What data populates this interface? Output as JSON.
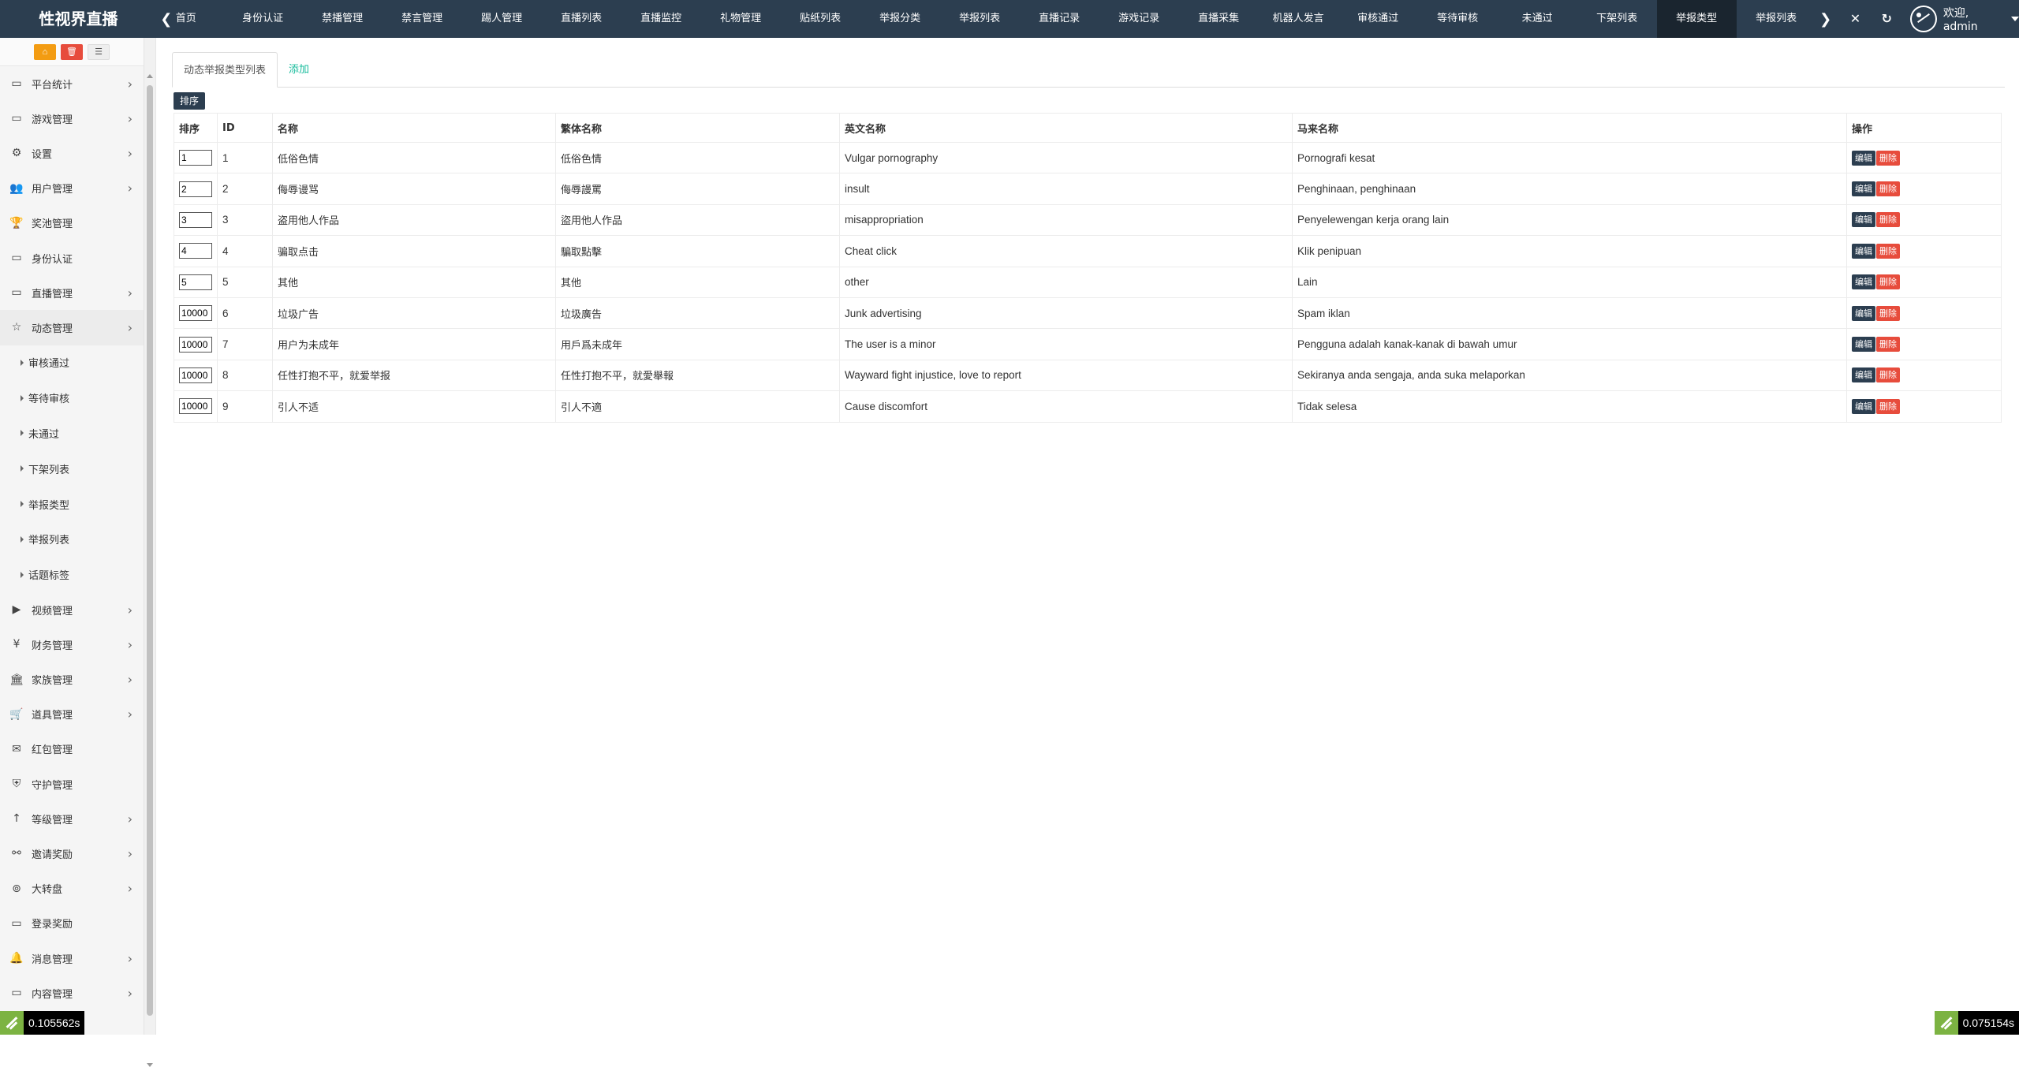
{
  "brand": "性视界直播",
  "topnav": {
    "tabs": [
      "首页",
      "身份认证",
      "禁播管理",
      "禁言管理",
      "踢人管理",
      "直播列表",
      "直播监控",
      "礼物管理",
      "贴纸列表",
      "举报分类",
      "举报列表",
      "直播记录",
      "游戏记录",
      "直播采集",
      "机器人发言",
      "审核通过",
      "等待审核",
      "未通过",
      "下架列表",
      "举报类型",
      "举报列表"
    ],
    "active_tab_index": 19,
    "user_greeting": "欢迎, admin"
  },
  "sidebar": {
    "tools": [
      "home-icon",
      "trash-icon",
      "list-icon"
    ],
    "items": [
      {
        "label": "平台统计",
        "icon": "monitor-icon",
        "glyph": "▭",
        "has_children": true
      },
      {
        "label": "游戏管理",
        "icon": "monitor-icon",
        "glyph": "▭",
        "has_children": true
      },
      {
        "label": "设置",
        "icon": "gears-icon",
        "glyph": "⚙",
        "has_children": true
      },
      {
        "label": "用户管理",
        "icon": "users-icon",
        "glyph": "👥",
        "has_children": true
      },
      {
        "label": "奖池管理",
        "icon": "trophy-icon",
        "glyph": "🏆",
        "has_children": false
      },
      {
        "label": "身份认证",
        "icon": "monitor-icon",
        "glyph": "▭",
        "has_children": false
      },
      {
        "label": "直播管理",
        "icon": "monitor-icon",
        "glyph": "▭",
        "has_children": true
      },
      {
        "label": "动态管理",
        "icon": "star-icon",
        "glyph": "☆",
        "has_children": true,
        "open": true
      }
    ],
    "subitems": [
      "审核通过",
      "等待审核",
      "未通过",
      "下架列表",
      "举报类型",
      "举报列表",
      "话题标签"
    ],
    "items_after": [
      {
        "label": "视频管理",
        "icon": "video-icon",
        "glyph": "▶",
        "has_children": true
      },
      {
        "label": "财务管理",
        "icon": "yen-icon",
        "glyph": "¥",
        "has_children": true
      },
      {
        "label": "家族管理",
        "icon": "bank-icon",
        "glyph": "🏛",
        "has_children": true
      },
      {
        "label": "道具管理",
        "icon": "cart-icon",
        "glyph": "🛒",
        "has_children": true
      },
      {
        "label": "红包管理",
        "icon": "envelope-icon",
        "glyph": "✉",
        "has_children": false
      },
      {
        "label": "守护管理",
        "icon": "shield-icon",
        "glyph": "⛨",
        "has_children": false
      },
      {
        "label": "等级管理",
        "icon": "level-up-icon",
        "glyph": "↑",
        "has_children": true
      },
      {
        "label": "邀请奖励",
        "icon": "sitemap-icon",
        "glyph": "⚯",
        "has_children": true
      },
      {
        "label": "大转盘",
        "icon": "gamepad-icon",
        "glyph": "⊚",
        "has_children": true
      },
      {
        "label": "登录奖励",
        "icon": "monitor-icon",
        "glyph": "▭",
        "has_children": false
      },
      {
        "label": "消息管理",
        "icon": "bell-icon",
        "glyph": "🔔",
        "has_children": true
      },
      {
        "label": "内容管理",
        "icon": "monitor-icon",
        "glyph": "▭",
        "has_children": true
      }
    ]
  },
  "content": {
    "tabs": [
      "动态举报类型列表",
      "添加"
    ],
    "sort_button": "排序",
    "columns": [
      "排序",
      "ID",
      "名称",
      "繁体名称",
      "英文名称",
      "马来名称",
      "操作"
    ],
    "rows": [
      {
        "sort": "1",
        "id": "1",
        "name": "低俗色情",
        "name_tw": "低俗色情",
        "name_en": "Vulgar pornography",
        "name_ms": "Pornografi kesat"
      },
      {
        "sort": "2",
        "id": "2",
        "name": "侮辱谩骂",
        "name_tw": "侮辱謾罵",
        "name_en": "insult",
        "name_ms": "Penghinaan, penghinaan"
      },
      {
        "sort": "3",
        "id": "3",
        "name": "盗用他人作品",
        "name_tw": "盜用他人作品",
        "name_en": "misappropriation",
        "name_ms": "Penyelewengan kerja orang lain"
      },
      {
        "sort": "4",
        "id": "4",
        "name": "骗取点击",
        "name_tw": "騙取點擊",
        "name_en": "Cheat click",
        "name_ms": "Klik penipuan"
      },
      {
        "sort": "5",
        "id": "5",
        "name": "其他",
        "name_tw": "其他",
        "name_en": "other",
        "name_ms": "Lain"
      },
      {
        "sort": "10000",
        "id": "6",
        "name": "垃圾广告",
        "name_tw": "垃圾廣告",
        "name_en": "Junk advertising",
        "name_ms": "Spam iklan"
      },
      {
        "sort": "10000",
        "id": "7",
        "name": "用户为未成年",
        "name_tw": "用戶爲未成年",
        "name_en": "The user is a minor",
        "name_ms": "Pengguna adalah kanak-kanak di bawah umur"
      },
      {
        "sort": "10000",
        "id": "8",
        "name": "任性打抱不平，就爱举报",
        "name_tw": "任性打抱不平，就愛舉報",
        "name_en": "Wayward fight injustice, love to report",
        "name_ms": "Sekiranya anda sengaja, anda suka melaporkan"
      },
      {
        "sort": "10000",
        "id": "9",
        "name": "引人不适",
        "name_tw": "引人不適",
        "name_en": "Cause discomfort",
        "name_ms": "Tidak selesa"
      }
    ],
    "edit_label": "编辑",
    "delete_label": "删除"
  },
  "timers": {
    "left": "0.105562s",
    "right": "0.075154s"
  },
  "colors": {
    "navbar": "#2c3e50",
    "active_tab": "#1a252f",
    "danger": "#e74c3c",
    "link": "#18bc9c"
  }
}
